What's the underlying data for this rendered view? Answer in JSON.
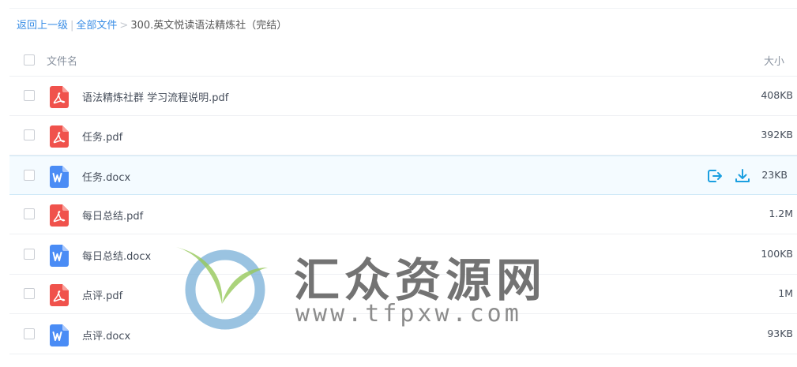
{
  "breadcrumb": {
    "back": "返回上一级",
    "sep1": "|",
    "all_files": "全部文件",
    "sep2": ">",
    "current": "300.英文悦读语法精炼社（完结）"
  },
  "table_header": {
    "name": "文件名",
    "size": "大小"
  },
  "files": [
    {
      "name": "语法精炼社群 学习流程说明.pdf",
      "size": "408KB",
      "icon": "pdf-icon"
    },
    {
      "name": "任务.pdf",
      "size": "392KB",
      "icon": "pdf-icon"
    },
    {
      "name": "任务.docx",
      "size": "23KB",
      "icon": "word-icon"
    },
    {
      "name": "每日总结.pdf",
      "size": "1.2M",
      "icon": "pdf-icon"
    },
    {
      "name": "每日总结.docx",
      "size": "100KB",
      "icon": "word-icon"
    },
    {
      "name": "点评.pdf",
      "size": "1M",
      "icon": "pdf-icon"
    },
    {
      "name": "点评.docx",
      "size": "93KB",
      "icon": "word-icon"
    }
  ],
  "watermark": {
    "text": "汇众资源网",
    "url": "www.tfpxw.com"
  },
  "colors": {
    "link": "#3a8ee6",
    "pdf": "#f0524c",
    "word": "#4a8cf5",
    "action": "#1a9fe0"
  }
}
